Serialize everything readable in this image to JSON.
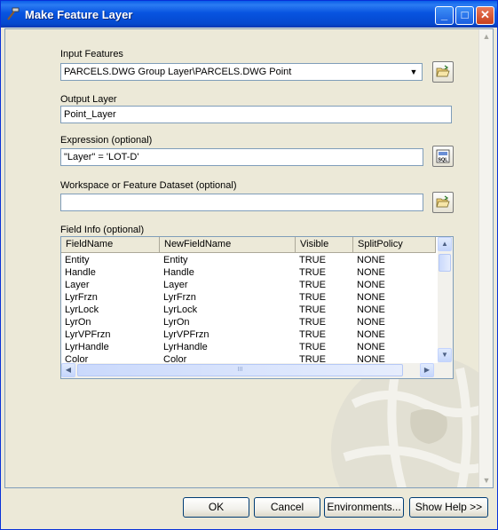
{
  "window": {
    "title": "Make Feature Layer"
  },
  "input_features": {
    "label": "Input Features",
    "value": "PARCELS.DWG Group Layer\\PARCELS.DWG Point"
  },
  "output_layer": {
    "label": "Output Layer",
    "value": "Point_Layer"
  },
  "expression": {
    "label": "Expression (optional)",
    "value": "\"Layer\" = 'LOT-D'",
    "sql_button": "SQL"
  },
  "workspace": {
    "label": "Workspace or Feature Dataset (optional)",
    "value": ""
  },
  "field_info": {
    "label": "Field Info (optional)",
    "columns": [
      "FieldName",
      "NewFieldName",
      "Visible",
      "SplitPolicy"
    ],
    "rows": [
      [
        "Entity",
        "Entity",
        "TRUE",
        "NONE"
      ],
      [
        "Handle",
        "Handle",
        "TRUE",
        "NONE"
      ],
      [
        "Layer",
        "Layer",
        "TRUE",
        "NONE"
      ],
      [
        "LyrFrzn",
        "LyrFrzn",
        "TRUE",
        "NONE"
      ],
      [
        "LyrLock",
        "LyrLock",
        "TRUE",
        "NONE"
      ],
      [
        "LyrOn",
        "LyrOn",
        "TRUE",
        "NONE"
      ],
      [
        "LyrVPFrzn",
        "LyrVPFrzn",
        "TRUE",
        "NONE"
      ],
      [
        "LyrHandle",
        "LyrHandle",
        "TRUE",
        "NONE"
      ],
      [
        "Color",
        "Color",
        "TRUE",
        "NONE"
      ]
    ],
    "hscroll_grip": "III"
  },
  "buttons": {
    "ok": "OK",
    "cancel": "Cancel",
    "environments": "Environments...",
    "show_help": "Show Help >>"
  },
  "colors": {
    "titlebar": "#0854e0",
    "face": "#ece9d8",
    "border": "#7f9db9"
  }
}
